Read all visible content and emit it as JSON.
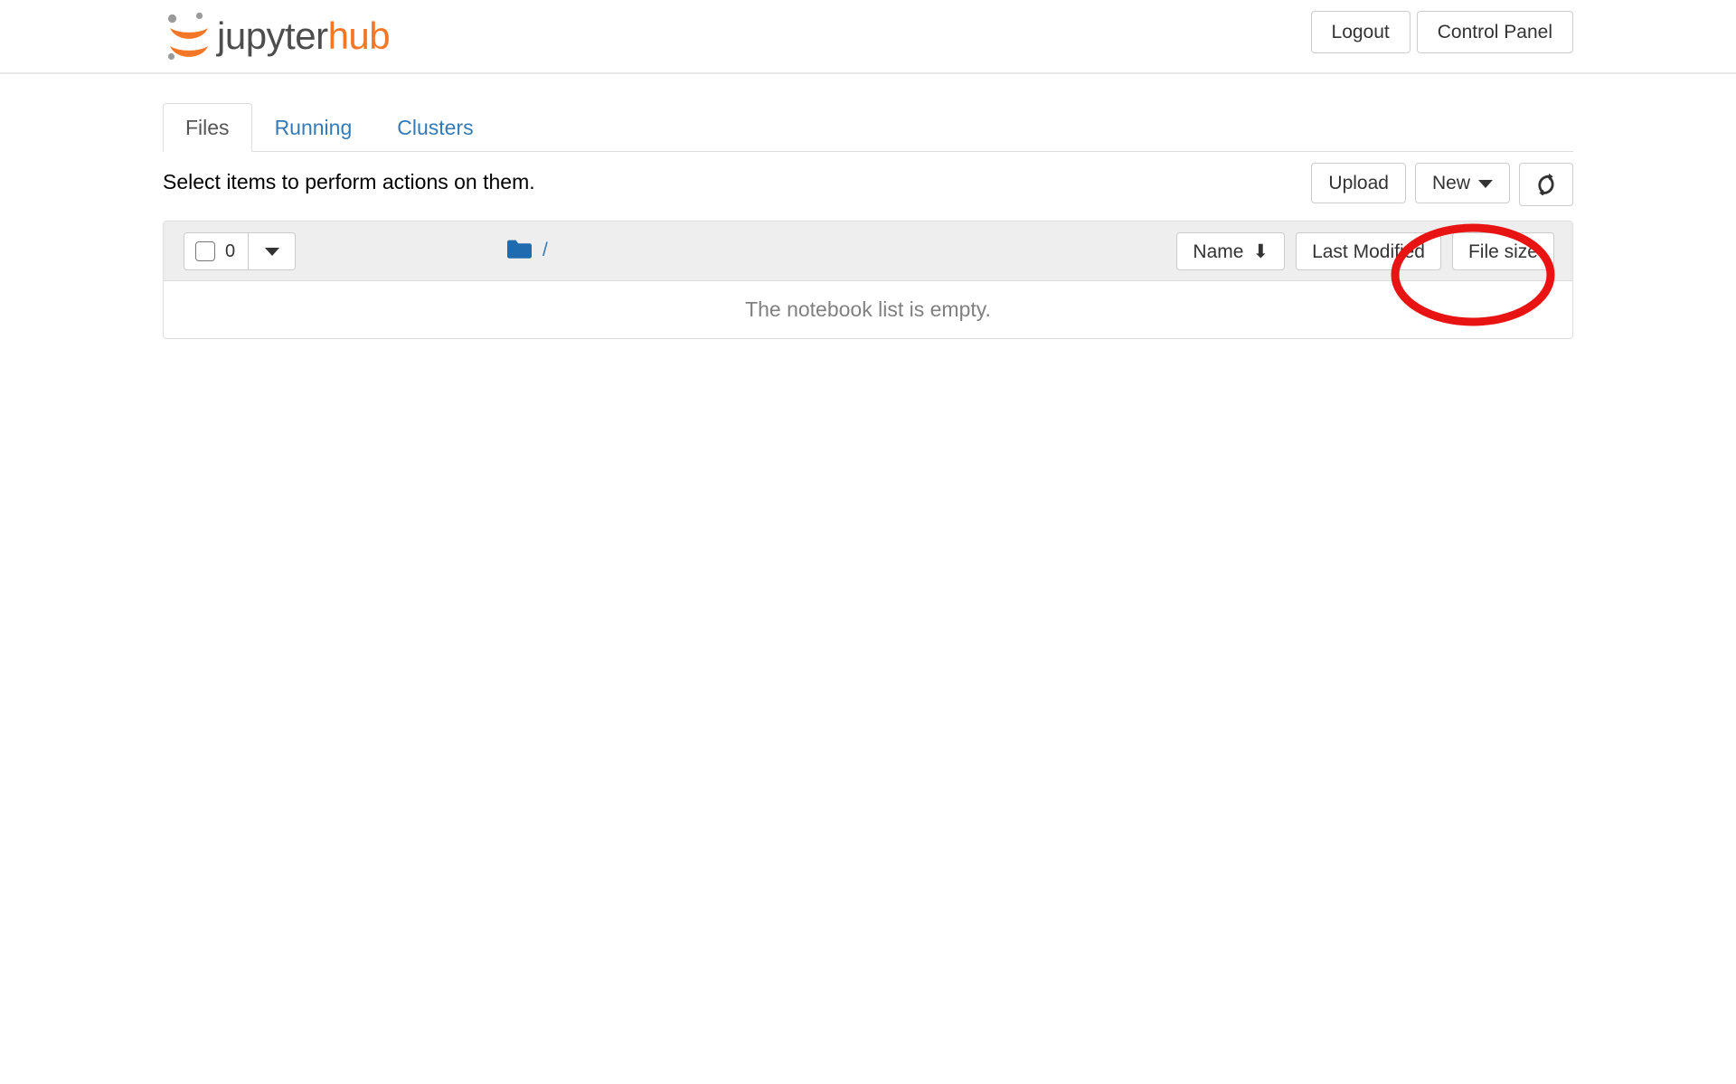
{
  "header": {
    "brand": {
      "text_primary": "jupyter",
      "text_secondary": "hub",
      "logo_icon": "jupyter-logo-icon",
      "color_primary": "#4d4d4d",
      "color_secondary": "#f37726"
    },
    "buttons": [
      {
        "label": "Logout",
        "name": "logout-button"
      },
      {
        "label": "Control Panel",
        "name": "control-panel-button"
      }
    ]
  },
  "tabs": [
    {
      "label": "Files",
      "active": true
    },
    {
      "label": "Running",
      "active": false
    },
    {
      "label": "Clusters",
      "active": false
    }
  ],
  "toolbar": {
    "hint_text": "Select items to perform actions on them.",
    "upload_label": "Upload",
    "new_label": "New",
    "new_caret_icon": "caret-down-icon",
    "refresh_icon": "refresh-icon"
  },
  "file_list": {
    "select_all_count": "0",
    "select_all_caret_icon": "caret-down-icon",
    "folder_icon": "folder-icon",
    "breadcrumb_root": "/",
    "sort_buttons": [
      {
        "label": "Name",
        "arrow": "⬇",
        "active": true
      },
      {
        "label": "Last Modified",
        "arrow": "",
        "active": false
      },
      {
        "label": "File size",
        "arrow": "",
        "active": false
      }
    ],
    "empty_message": "The notebook list is empty."
  },
  "annotation": {
    "type": "ellipse-highlight",
    "target": "new-button",
    "color": "#e81313"
  }
}
